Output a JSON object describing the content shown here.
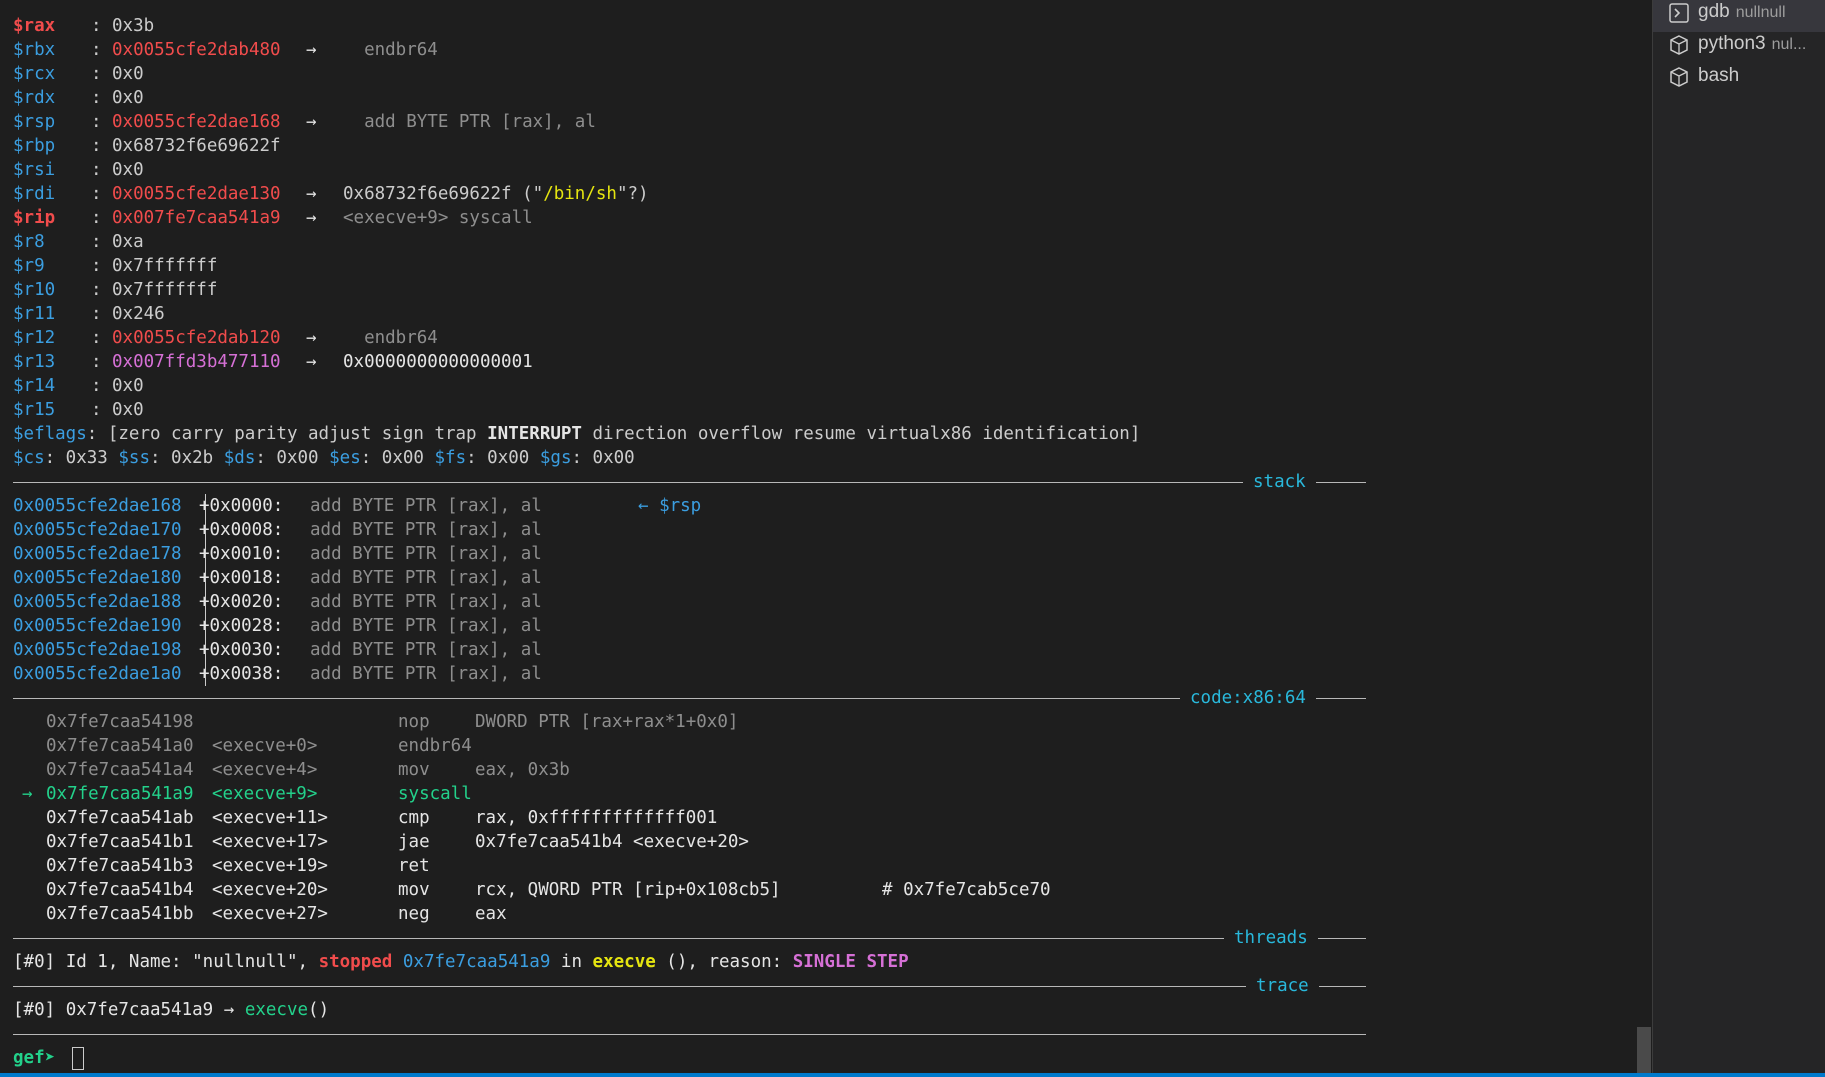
{
  "registers": [
    {
      "name": "$rax",
      "val": "0x3b",
      "kind": "plain",
      "label_class": "c-redb"
    },
    {
      "name": "$rbx",
      "val": "0x0055cfe2dab480",
      "kind": "ptr",
      "val_class": "c-red",
      "arrow": "→",
      "target": "  endbr64",
      "target_class": "c-gray"
    },
    {
      "name": "$rcx",
      "val": "0x0",
      "kind": "plain"
    },
    {
      "name": "$rdx",
      "val": "0x0",
      "kind": "plain"
    },
    {
      "name": "$rsp",
      "val": "0x0055cfe2dae168",
      "kind": "ptr",
      "val_class": "c-red",
      "arrow": "→",
      "target": "  add BYTE PTR [rax], al",
      "target_class": "c-gray"
    },
    {
      "name": "$rbp",
      "val": "0x68732f6e69622f",
      "kind": "plain"
    },
    {
      "name": "$rsi",
      "val": "0x0",
      "kind": "plain"
    },
    {
      "name": "$rdi",
      "val": "0x0055cfe2dae130",
      "kind": "str",
      "val_class": "c-red",
      "arrow": "→",
      "target": "0x68732f6e69622f (\"",
      "target_str": "/bin/sh",
      "target_tail": "\"?)"
    },
    {
      "name": "$rip",
      "val": "0x007fe7caa541a9",
      "kind": "ptr",
      "label_class": "c-redb",
      "val_class": "c-red",
      "arrow": "→",
      "target": "<execve+9> syscall",
      "target_class": "c-gray"
    },
    {
      "name": "$r8",
      "val": "0xa",
      "kind": "plain"
    },
    {
      "name": "$r9",
      "val": "0x7fffffff",
      "kind": "plain"
    },
    {
      "name": "$r10",
      "val": "0x7fffffff",
      "kind": "plain"
    },
    {
      "name": "$r11",
      "val": "0x246",
      "kind": "plain"
    },
    {
      "name": "$r12",
      "val": "0x0055cfe2dab120",
      "kind": "ptr",
      "val_class": "c-red",
      "arrow": "→",
      "target": "  endbr64",
      "target_class": "c-gray"
    },
    {
      "name": "$r13",
      "val": "0x007ffd3b477110",
      "kind": "ptr",
      "val_class": "c-magenta",
      "arrow": "→",
      "target": "0x0000000000000001",
      "target_class": "c-white"
    },
    {
      "name": "$r14",
      "val": "0x0",
      "kind": "plain"
    },
    {
      "name": "$r15",
      "val": "0x0",
      "kind": "plain"
    }
  ],
  "eflags": {
    "label": "$eflags",
    "pre": ": [zero carry parity adjust sign trap ",
    "bold": "INTERRUPT",
    "post": " direction overflow resume virtualx86 identification]"
  },
  "segments": [
    {
      "name": "$cs",
      "val": ": 0x33 "
    },
    {
      "name": "$ss",
      "val": ": 0x2b "
    },
    {
      "name": "$ds",
      "val": ": 0x00 "
    },
    {
      "name": "$es",
      "val": ": 0x00 "
    },
    {
      "name": "$fs",
      "val": ": 0x00 "
    },
    {
      "name": "$gs",
      "val": ": 0x00"
    }
  ],
  "sections": {
    "stack": "stack",
    "code": "code:x86:64",
    "threads": "threads",
    "trace": "trace"
  },
  "stack": [
    {
      "addr": "0x0055cfe2dae168",
      "off": "+0x0000:",
      "ins": "add BYTE PTR [rax], al",
      "note": "← $rsp"
    },
    {
      "addr": "0x0055cfe2dae170",
      "off": "+0x0008:",
      "ins": "add BYTE PTR [rax], al",
      "note": ""
    },
    {
      "addr": "0x0055cfe2dae178",
      "off": "+0x0010:",
      "ins": "add BYTE PTR [rax], al",
      "note": ""
    },
    {
      "addr": "0x0055cfe2dae180",
      "off": "+0x0018:",
      "ins": "add BYTE PTR [rax], al",
      "note": ""
    },
    {
      "addr": "0x0055cfe2dae188",
      "off": "+0x0020:",
      "ins": "add BYTE PTR [rax], al",
      "note": ""
    },
    {
      "addr": "0x0055cfe2dae190",
      "off": "+0x0028:",
      "ins": "add BYTE PTR [rax], al",
      "note": ""
    },
    {
      "addr": "0x0055cfe2dae198",
      "off": "+0x0030:",
      "ins": "add BYTE PTR [rax], al",
      "note": ""
    },
    {
      "addr": "0x0055cfe2dae1a0",
      "off": "+0x0038:",
      "ins": "add BYTE PTR [rax], al",
      "note": ""
    }
  ],
  "code": [
    {
      "marker": "",
      "addr": "0x7fe7caa54198",
      "sym": "",
      "mn": "nop",
      "ops": "DWORD PTR [rax+rax*1+0x0]",
      "cmt": "",
      "state": "past"
    },
    {
      "marker": "",
      "addr": "0x7fe7caa541a0",
      "sym": "<execve+0>",
      "mn": "endbr64",
      "ops": "",
      "cmt": "",
      "state": "past"
    },
    {
      "marker": "",
      "addr": "0x7fe7caa541a4",
      "sym": "<execve+4>",
      "mn": "mov",
      "ops": "eax, 0x3b",
      "cmt": "",
      "state": "past"
    },
    {
      "marker": "→",
      "addr": "0x7fe7caa541a9",
      "sym": "<execve+9>",
      "mn": "syscall",
      "ops": "",
      "cmt": "",
      "state": "current"
    },
    {
      "marker": "",
      "addr": "0x7fe7caa541ab",
      "sym": "<execve+11>",
      "mn": "cmp",
      "ops": "rax, 0xfffffffffffff001",
      "cmt": "",
      "state": "next"
    },
    {
      "marker": "",
      "addr": "0x7fe7caa541b1",
      "sym": "<execve+17>",
      "mn": "jae",
      "ops": "0x7fe7caa541b4 <execve+20>",
      "cmt": "",
      "state": "next"
    },
    {
      "marker": "",
      "addr": "0x7fe7caa541b3",
      "sym": "<execve+19>",
      "mn": "ret",
      "ops": "",
      "cmt": "",
      "state": "next"
    },
    {
      "marker": "",
      "addr": "0x7fe7caa541b4",
      "sym": "<execve+20>",
      "mn": "mov",
      "ops": "rcx, QWORD PTR [rip+0x108cb5]",
      "cmt": "# 0x7fe7cab5ce70",
      "state": "next"
    },
    {
      "marker": "",
      "addr": "0x7fe7caa541bb",
      "sym": "<execve+27>",
      "mn": "neg",
      "ops": "eax",
      "cmt": "",
      "state": "next"
    }
  ],
  "threads": {
    "id": "[#0]",
    "mid": " Id 1, Name: \"nullnull\", ",
    "status": "stopped",
    "addr": "0x7fe7caa541a9",
    "in": " in ",
    "func": "execve",
    "post": " (), reason: ",
    "reason": "SINGLE STEP"
  },
  "trace": {
    "id": "[#0]",
    "addr": " 0x7fe7caa541a9 → ",
    "func": "execve",
    "post": "()"
  },
  "prompt": {
    "text": "gef➤ "
  },
  "terminal_tabs": [
    {
      "label": "gdb",
      "sub": "nullnull",
      "icon": "terminal-icon",
      "active": true
    },
    {
      "label": "python3",
      "sub": "nul...",
      "icon": "box-icon",
      "active": false
    },
    {
      "label": "bash",
      "sub": "",
      "icon": "box-icon",
      "active": false
    }
  ]
}
